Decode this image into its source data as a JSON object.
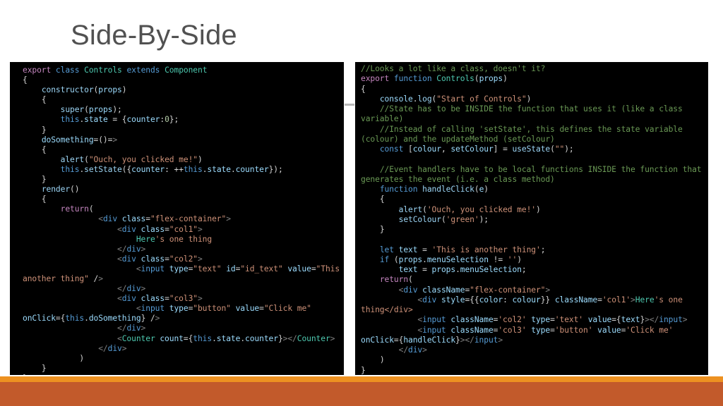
{
  "slide": {
    "title": "Side-By-Side",
    "accent_thin_color": "#ed9121",
    "accent_thick_color": "#c25a2b",
    "title_color": "#515151",
    "code_background": "#000000"
  },
  "left_code": {
    "language": "jsx",
    "text": "export class Controls extends Component\n{\n    constructor(props)\n    {\n        super(props);\n        this.state = {counter:0};\n    }\n    doSomething=()=>\n    {\n        alert(\"Ouch, you clicked me!\")\n        this.setState({counter: ++this.state.counter});\n    }\n    render()\n    {\n        return(\n                <div class=\"flex-container\">\n                    <div class=\"col1\">\n                        Here's one thing\n                    </div>\n                    <div class=\"col2\">\n                        <input type=\"text\" id=\"id_text\" value=\"This another thing\" />\n                    </div>\n                    <div class=\"col3\">\n                        <input type=\"button\" value=\"Click me\" onClick={this.doSomething} />\n                    </div>\n                    <Counter count={this.state.counter}></Counter>\n                </div>\n            )\n    }\n}"
  },
  "right_code": {
    "language": "jsx",
    "text": "//Looks a lot like a class, doesn't it?\nexport function Controls(props)\n{\n    console.log(\"Start of Controls\")\n    //State has to be INSIDE the function that uses it (like a class variable)\n    //Instead of calling 'setState', this defines the state variable (colour) and the updateMethod (setColour)\n    const [colour, setColour] = useState(\"\");\n\n    //Event handlers have to be local functions INSIDE the function that generates the event (i.e. a class method)\n    function handleClick(e)\n    {\n        alert('Ouch, you clicked me!')\n        setColour('green');\n    }\n\n    let text = 'This is another thing';\n    if (props.menuSelection != '')\n        text = props.menuSelection;\n    return(\n        <div className=\"flex-container\">\n            <div style={{color: colour}} className='col1'>Here's one thing</div>\n            <input className='col2' type='text' value={text}></input>\n            <input className='col3' type='button' value='Click me' onClick={handleClick}></input>\n        </div>\n    )\n}"
  }
}
